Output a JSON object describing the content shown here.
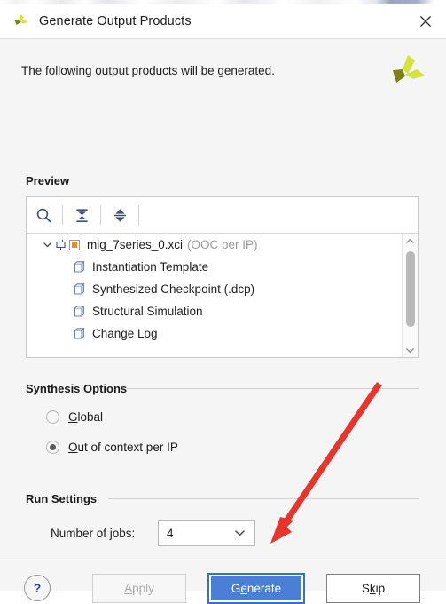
{
  "window": {
    "title": "Generate Output Products",
    "app_icon": "vivado-logo-icon",
    "close_icon": "close-icon"
  },
  "body": {
    "intro_text": "The following output products will be generated.",
    "brand_icon": "xilinx-logo-icon"
  },
  "preview": {
    "label": "Preview",
    "toolbar": [
      {
        "name": "search-icon",
        "tooltip": "Search"
      },
      {
        "name": "collapse-all-icon",
        "tooltip": "Collapse All"
      },
      {
        "name": "expand-all-icon",
        "tooltip": "Expand All"
      }
    ],
    "tree": {
      "root": {
        "expand_icon": "chevron-down-icon",
        "ip_icon": "ip-core-icon",
        "state_icon": "orange-square-icon",
        "label": "mig_7series_0.xci",
        "note": "(OOC per IP)"
      },
      "children": [
        {
          "icon": "file-icon",
          "label": "Instantiation Template"
        },
        {
          "icon": "file-icon",
          "label": "Synthesized Checkpoint (.dcp)"
        },
        {
          "icon": "file-icon",
          "label": "Structural Simulation"
        },
        {
          "icon": "file-icon",
          "label": "Change Log"
        }
      ]
    },
    "scrollbar": {
      "up_icon": "chevron-up-icon",
      "down_icon": "chevron-down-icon"
    }
  },
  "synthesis_options": {
    "title": "Synthesis Options",
    "radios": [
      {
        "label_pre": "",
        "mnemonic": "G",
        "label_post": "lobal",
        "selected": false
      },
      {
        "label_pre": "",
        "mnemonic": "O",
        "label_post": "ut of context per IP",
        "selected": true
      }
    ]
  },
  "run_settings": {
    "title": "Run Settings",
    "jobs_label_pre": "Number of ",
    "jobs_label_mnemonic": "j",
    "jobs_label_post": "obs:",
    "jobs_value": "4",
    "jobs_caret_icon": "chevron-down-icon"
  },
  "footer": {
    "help_label": "?",
    "help_icon": "help-icon",
    "buttons": [
      {
        "name": "apply-button",
        "pre": "",
        "mnemonic": "A",
        "post": "pply",
        "enabled": false,
        "default": false
      },
      {
        "name": "generate-button",
        "pre": "G",
        "mnemonic": "e",
        "post": "nerate",
        "enabled": true,
        "default": true
      },
      {
        "name": "skip-button",
        "pre": "S",
        "mnemonic": "k",
        "post": "ip",
        "enabled": true,
        "default": false
      }
    ]
  },
  "annotation": {
    "arrow_color": "#e8342a",
    "points_to": "generate-button"
  },
  "colors": {
    "accent_blue": "#4b7ed6",
    "dialog_bg": "#f5f5f5",
    "panel_bg": "#ffffff",
    "brand_green": "#c8d93b",
    "ip_orange": "#f08a1e"
  }
}
